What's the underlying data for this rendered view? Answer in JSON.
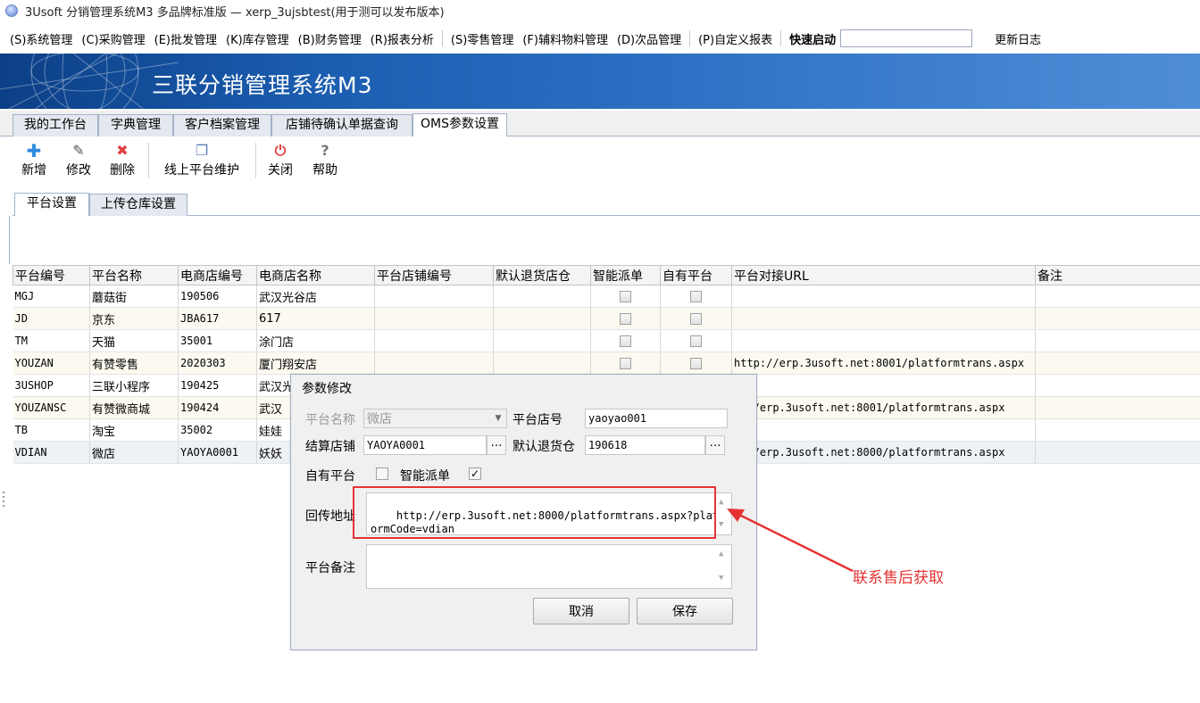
{
  "window": {
    "title": "3Usoft 分销管理系统M3 多品牌标准版 — xerp_3ujsbtest(用于测可以发布版本)"
  },
  "menubar": {
    "items": [
      "(S)系统管理",
      "(C)采购管理",
      "(E)批发管理",
      "(K)库存管理",
      "(B)财务管理",
      "(R)报表分析",
      "(S)零售管理",
      "(F)辅料物料管理",
      "(D)次品管理",
      "(P)自定义报表"
    ],
    "quick_start_label": "快速启动",
    "quick_start_value": "",
    "changelog_label": "更新日志"
  },
  "banner": {
    "brand": "三联分销管理系统M3"
  },
  "tabs": [
    "我的工作台",
    "字典管理",
    "客户档案管理",
    "店铺待确认单据查询",
    "OMS参数设置"
  ],
  "active_tab": "OMS参数设置",
  "toolbar": {
    "add": "新增",
    "edit": "修改",
    "delete": "删除",
    "platform_maintain": "线上平台维护",
    "close": "关闭",
    "help": "帮助"
  },
  "subtabs": [
    "平台设置",
    "上传仓库设置"
  ],
  "grid": {
    "columns": [
      "平台编号",
      "平台名称",
      "电商店编号",
      "电商店名称",
      "平台店铺编号",
      "默认退货店仓",
      "智能派单",
      "自有平台",
      "平台对接URL",
      "备注"
    ],
    "rows": [
      {
        "code": "MGJ",
        "name": "蘑菇街",
        "shop_no": "190506",
        "shop_name": "武汉光谷店",
        "url": ""
      },
      {
        "code": "JD",
        "name": "京东",
        "shop_no": " JBA617",
        "shop_name": "617",
        "url": ""
      },
      {
        "code": "TM",
        "name": "天猫",
        "shop_no": "35001",
        "shop_name": "涂门店",
        "url": ""
      },
      {
        "code": "YOUZAN",
        "name": "有赞零售",
        "shop_no": "2020303",
        "shop_name": "厦门翔安店",
        "url": "http://erp.3usoft.net:8001/platformtrans.aspx"
      },
      {
        "code": "3USHOP",
        "name": "三联小程序",
        "shop_no": "190425",
        "shop_name": "武汉光",
        "url": ""
      },
      {
        "code": "YOUZANSC",
        "name": "有赞微商城",
        "shop_no": "190424",
        "shop_name": "武汉",
        "url": "p://erp.3usoft.net:8001/platformtrans.aspx"
      },
      {
        "code": "TB",
        "name": "淘宝",
        "shop_no": "35002",
        "shop_name": "娃娃",
        "url": ""
      },
      {
        "code": "VDIAN",
        "name": "微店",
        "shop_no": "YAOYA0001",
        "shop_name": "妖妖",
        "url": "p://erp.3usoft.net:8000/platformtrans.aspx"
      }
    ]
  },
  "dialog": {
    "title": "参数修改",
    "platform_name_label": "平台名称",
    "platform_name_value": "微店",
    "platform_shop_no_label": "平台店号",
    "platform_shop_no_value": "yaoyao001",
    "settle_shop_label": "结算店铺",
    "settle_shop_value": "YAOYA0001",
    "default_return_label": "默认退货仓",
    "default_return_value": "190618",
    "own_platform_label": "自有平台",
    "own_platform_checked": false,
    "smart_dispatch_label": "智能派单",
    "smart_dispatch_checked": true,
    "callback_label": "回传地址",
    "callback_value": "http://erp.3usoft.net:8000/platformtrans.aspx?platformCode=vdian",
    "remark_label": "平台备注",
    "remark_value": "",
    "cancel": "取消",
    "save": "保存"
  },
  "annotation": {
    "text": "联系售后获取",
    "color": "#e53333"
  },
  "colors": {
    "banner_dark": "#0c3f86",
    "banner_light": "#4f8ed6",
    "annotation_red": "#e53333"
  }
}
